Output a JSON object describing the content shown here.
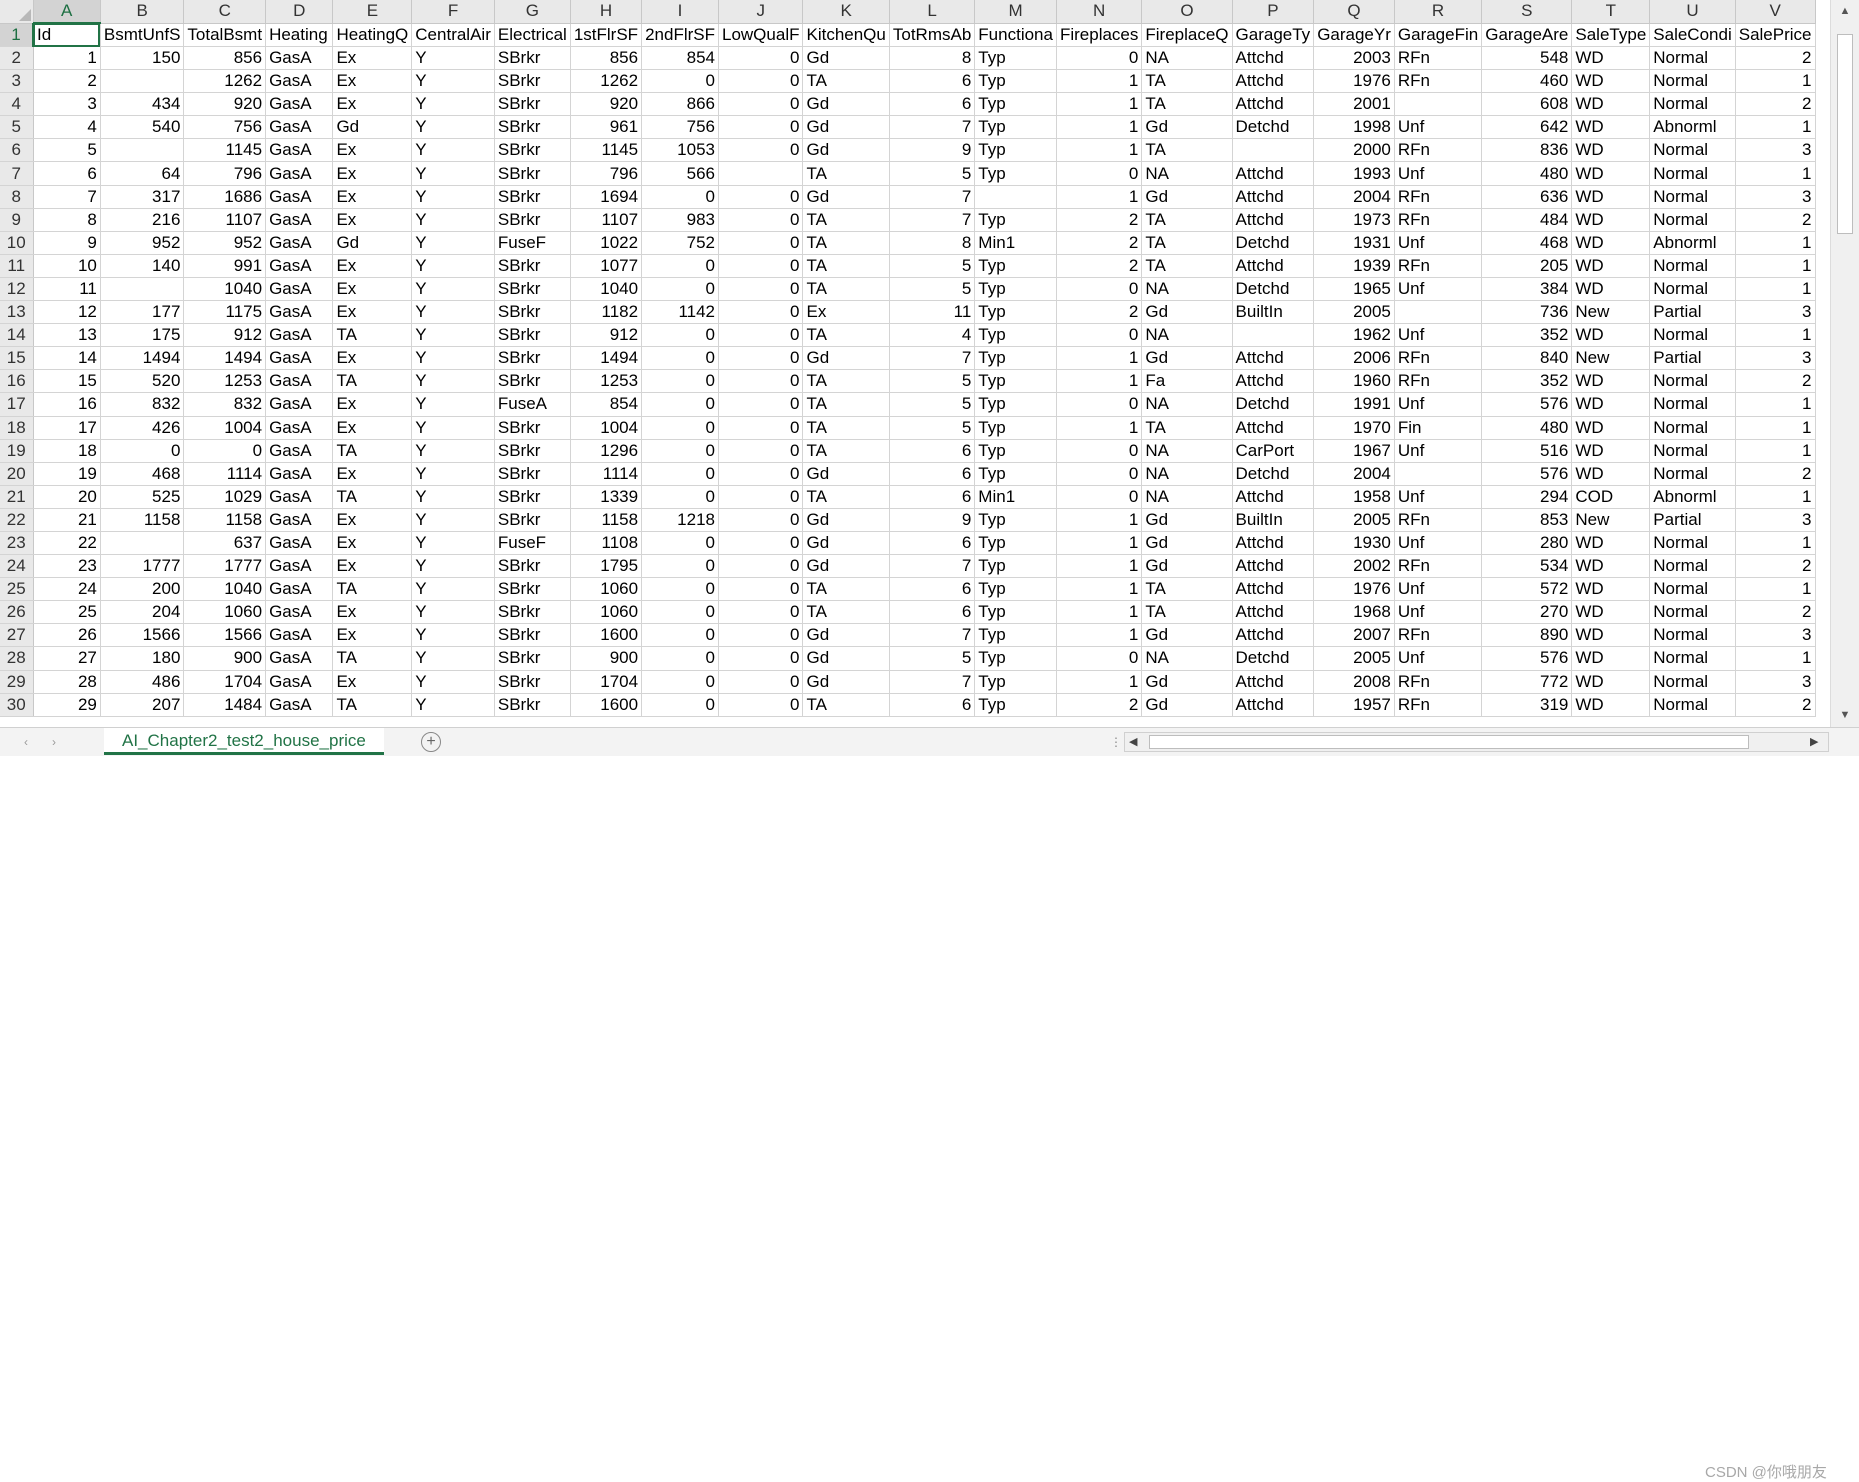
{
  "sheet": {
    "columns": [
      "A",
      "B",
      "C",
      "D",
      "E",
      "F",
      "G",
      "H",
      "I",
      "J",
      "K",
      "L",
      "M",
      "N",
      "O",
      "P",
      "Q",
      "R",
      "S",
      "T",
      "U",
      "V"
    ],
    "selected_cell": "A1",
    "rows": [
      {
        "n": "1",
        "c": [
          "Id",
          "BsmtUnfS",
          "TotalBsmt",
          "Heating",
          "HeatingQ",
          "CentralAir",
          "Electrical",
          "1stFlrSF",
          "2ndFlrSF",
          "LowQualF",
          "KitchenQu",
          "TotRmsAb",
          "Functiona",
          "Fireplaces",
          "FireplaceQ",
          "GarageTy",
          "GarageYr",
          "GarageFin",
          "GarageAre",
          "SaleType",
          "SaleCondi",
          "SalePrice"
        ]
      },
      {
        "n": "2",
        "c": [
          "1",
          "150",
          "856",
          "GasA",
          "Ex",
          "Y",
          "SBrkr",
          "856",
          "854",
          "0",
          "Gd",
          "8",
          "Typ",
          "0",
          "NA",
          "Attchd",
          "2003",
          "RFn",
          "548",
          "WD",
          "Normal",
          "2"
        ]
      },
      {
        "n": "3",
        "c": [
          "2",
          "",
          "1262",
          "GasA",
          "Ex",
          "Y",
          "SBrkr",
          "1262",
          "0",
          "0",
          "TA",
          "6",
          "Typ",
          "1",
          "TA",
          "Attchd",
          "1976",
          "RFn",
          "460",
          "WD",
          "Normal",
          "1"
        ]
      },
      {
        "n": "4",
        "c": [
          "3",
          "434",
          "920",
          "GasA",
          "Ex",
          "Y",
          "SBrkr",
          "920",
          "866",
          "0",
          "Gd",
          "6",
          "Typ",
          "1",
          "TA",
          "Attchd",
          "2001",
          "",
          "608",
          "WD",
          "Normal",
          "2"
        ]
      },
      {
        "n": "5",
        "c": [
          "4",
          "540",
          "756",
          "GasA",
          "Gd",
          "Y",
          "SBrkr",
          "961",
          "756",
          "0",
          "Gd",
          "7",
          "Typ",
          "1",
          "Gd",
          "Detchd",
          "1998",
          "Unf",
          "642",
          "WD",
          "Abnorml",
          "1"
        ]
      },
      {
        "n": "6",
        "c": [
          "5",
          "",
          "1145",
          "GasA",
          "Ex",
          "Y",
          "SBrkr",
          "1145",
          "1053",
          "0",
          "Gd",
          "9",
          "Typ",
          "1",
          "TA",
          "",
          "2000",
          "RFn",
          "836",
          "WD",
          "Normal",
          "3"
        ]
      },
      {
        "n": "7",
        "c": [
          "6",
          "64",
          "796",
          "GasA",
          "Ex",
          "Y",
          "SBrkr",
          "796",
          "566",
          "",
          "TA",
          "5",
          "Typ",
          "0",
          "NA",
          "Attchd",
          "1993",
          "Unf",
          "480",
          "WD",
          "Normal",
          "1"
        ]
      },
      {
        "n": "8",
        "c": [
          "7",
          "317",
          "1686",
          "GasA",
          "Ex",
          "Y",
          "SBrkr",
          "1694",
          "0",
          "0",
          "Gd",
          "7",
          "",
          "1",
          "Gd",
          "Attchd",
          "2004",
          "RFn",
          "636",
          "WD",
          "Normal",
          "3"
        ]
      },
      {
        "n": "9",
        "c": [
          "8",
          "216",
          "1107",
          "GasA",
          "Ex",
          "Y",
          "SBrkr",
          "1107",
          "983",
          "0",
          "TA",
          "7",
          "Typ",
          "2",
          "TA",
          "Attchd",
          "1973",
          "RFn",
          "484",
          "WD",
          "Normal",
          "2"
        ]
      },
      {
        "n": "10",
        "c": [
          "9",
          "952",
          "952",
          "GasA",
          "Gd",
          "Y",
          "FuseF",
          "1022",
          "752",
          "0",
          "TA",
          "8",
          "Min1",
          "2",
          "TA",
          "Detchd",
          "1931",
          "Unf",
          "468",
          "WD",
          "Abnorml",
          "1"
        ]
      },
      {
        "n": "11",
        "c": [
          "10",
          "140",
          "991",
          "GasA",
          "Ex",
          "Y",
          "SBrkr",
          "1077",
          "0",
          "0",
          "TA",
          "5",
          "Typ",
          "2",
          "TA",
          "Attchd",
          "1939",
          "RFn",
          "205",
          "WD",
          "Normal",
          "1"
        ]
      },
      {
        "n": "12",
        "c": [
          "11",
          "",
          "1040",
          "GasA",
          "Ex",
          "Y",
          "SBrkr",
          "1040",
          "0",
          "0",
          "TA",
          "5",
          "Typ",
          "0",
          "NA",
          "Detchd",
          "1965",
          "Unf",
          "384",
          "WD",
          "Normal",
          "1"
        ]
      },
      {
        "n": "13",
        "c": [
          "12",
          "177",
          "1175",
          "GasA",
          "Ex",
          "Y",
          "SBrkr",
          "1182",
          "1142",
          "0",
          "Ex",
          "11",
          "Typ",
          "2",
          "Gd",
          "BuiltIn",
          "2005",
          "",
          "736",
          "New",
          "Partial",
          "3"
        ]
      },
      {
        "n": "14",
        "c": [
          "13",
          "175",
          "912",
          "GasA",
          "TA",
          "Y",
          "SBrkr",
          "912",
          "0",
          "0",
          "TA",
          "4",
          "Typ",
          "0",
          "NA",
          "",
          "1962",
          "Unf",
          "352",
          "WD",
          "Normal",
          "1"
        ]
      },
      {
        "n": "15",
        "c": [
          "14",
          "1494",
          "1494",
          "GasA",
          "Ex",
          "Y",
          "SBrkr",
          "1494",
          "0",
          "0",
          "Gd",
          "7",
          "Typ",
          "1",
          "Gd",
          "Attchd",
          "2006",
          "RFn",
          "840",
          "New",
          "Partial",
          "3"
        ]
      },
      {
        "n": "16",
        "c": [
          "15",
          "520",
          "1253",
          "GasA",
          "TA",
          "Y",
          "SBrkr",
          "1253",
          "0",
          "0",
          "TA",
          "5",
          "Typ",
          "1",
          "Fa",
          "Attchd",
          "1960",
          "RFn",
          "352",
          "WD",
          "Normal",
          "2"
        ]
      },
      {
        "n": "17",
        "c": [
          "16",
          "832",
          "832",
          "GasA",
          "Ex",
          "Y",
          "FuseA",
          "854",
          "0",
          "0",
          "TA",
          "5",
          "Typ",
          "0",
          "NA",
          "Detchd",
          "1991",
          "Unf",
          "576",
          "WD",
          "Normal",
          "1"
        ]
      },
      {
        "n": "18",
        "c": [
          "17",
          "426",
          "1004",
          "GasA",
          "Ex",
          "Y",
          "SBrkr",
          "1004",
          "0",
          "0",
          "TA",
          "5",
          "Typ",
          "1",
          "TA",
          "Attchd",
          "1970",
          "Fin",
          "480",
          "WD",
          "Normal",
          "1"
        ]
      },
      {
        "n": "19",
        "c": [
          "18",
          "0",
          "0",
          "GasA",
          "TA",
          "Y",
          "SBrkr",
          "1296",
          "0",
          "0",
          "TA",
          "6",
          "Typ",
          "0",
          "NA",
          "CarPort",
          "1967",
          "Unf",
          "516",
          "WD",
          "Normal",
          "1"
        ]
      },
      {
        "n": "20",
        "c": [
          "19",
          "468",
          "1114",
          "GasA",
          "Ex",
          "Y",
          "SBrkr",
          "1114",
          "0",
          "0",
          "Gd",
          "6",
          "Typ",
          "0",
          "NA",
          "Detchd",
          "2004",
          "",
          "576",
          "WD",
          "Normal",
          "2"
        ]
      },
      {
        "n": "21",
        "c": [
          "20",
          "525",
          "1029",
          "GasA",
          "TA",
          "Y",
          "SBrkr",
          "1339",
          "0",
          "0",
          "TA",
          "6",
          "Min1",
          "0",
          "NA",
          "Attchd",
          "1958",
          "Unf",
          "294",
          "COD",
          "Abnorml",
          "1"
        ]
      },
      {
        "n": "22",
        "c": [
          "21",
          "1158",
          "1158",
          "GasA",
          "Ex",
          "Y",
          "SBrkr",
          "1158",
          "1218",
          "0",
          "Gd",
          "9",
          "Typ",
          "1",
          "Gd",
          "BuiltIn",
          "2005",
          "RFn",
          "853",
          "New",
          "Partial",
          "3"
        ]
      },
      {
        "n": "23",
        "c": [
          "22",
          "",
          "637",
          "GasA",
          "Ex",
          "Y",
          "FuseF",
          "1108",
          "0",
          "0",
          "Gd",
          "6",
          "Typ",
          "1",
          "Gd",
          "Attchd",
          "1930",
          "Unf",
          "280",
          "WD",
          "Normal",
          "1"
        ]
      },
      {
        "n": "24",
        "c": [
          "23",
          "1777",
          "1777",
          "GasA",
          "Ex",
          "Y",
          "SBrkr",
          "1795",
          "0",
          "0",
          "Gd",
          "7",
          "Typ",
          "1",
          "Gd",
          "Attchd",
          "2002",
          "RFn",
          "534",
          "WD",
          "Normal",
          "2"
        ]
      },
      {
        "n": "25",
        "c": [
          "24",
          "200",
          "1040",
          "GasA",
          "TA",
          "Y",
          "SBrkr",
          "1060",
          "0",
          "0",
          "TA",
          "6",
          "Typ",
          "1",
          "TA",
          "Attchd",
          "1976",
          "Unf",
          "572",
          "WD",
          "Normal",
          "1"
        ]
      },
      {
        "n": "26",
        "c": [
          "25",
          "204",
          "1060",
          "GasA",
          "Ex",
          "Y",
          "SBrkr",
          "1060",
          "0",
          "0",
          "TA",
          "6",
          "Typ",
          "1",
          "TA",
          "Attchd",
          "1968",
          "Unf",
          "270",
          "WD",
          "Normal",
          "2"
        ]
      },
      {
        "n": "27",
        "c": [
          "26",
          "1566",
          "1566",
          "GasA",
          "Ex",
          "Y",
          "SBrkr",
          "1600",
          "0",
          "0",
          "Gd",
          "7",
          "Typ",
          "1",
          "Gd",
          "Attchd",
          "2007",
          "RFn",
          "890",
          "WD",
          "Normal",
          "3"
        ]
      },
      {
        "n": "28",
        "c": [
          "27",
          "180",
          "900",
          "GasA",
          "TA",
          "Y",
          "SBrkr",
          "900",
          "0",
          "0",
          "Gd",
          "5",
          "Typ",
          "0",
          "NA",
          "Detchd",
          "2005",
          "Unf",
          "576",
          "WD",
          "Normal",
          "1"
        ]
      },
      {
        "n": "29",
        "c": [
          "28",
          "486",
          "1704",
          "GasA",
          "Ex",
          "Y",
          "SBrkr",
          "1704",
          "0",
          "0",
          "Gd",
          "7",
          "Typ",
          "1",
          "Gd",
          "Attchd",
          "2008",
          "RFn",
          "772",
          "WD",
          "Normal",
          "3"
        ]
      },
      {
        "n": "30",
        "c": [
          "29",
          "207",
          "1484",
          "GasA",
          "TA",
          "Y",
          "SBrkr",
          "1600",
          "0",
          "0",
          "TA",
          "6",
          "Typ",
          "2",
          "Gd",
          "Attchd",
          "1957",
          "RFn",
          "319",
          "WD",
          "Normal",
          "2"
        ]
      }
    ]
  },
  "tabs": {
    "sheet_name": "AI_Chapter2_test2_house_price",
    "add_symbol": "+",
    "prev_icon": "‹",
    "next_icon": "›",
    "split_icon": "⋮"
  },
  "scrollbars": {
    "up_icon": "▲",
    "down_icon": "▼",
    "left_icon": "◀",
    "right_icon": "▶"
  },
  "watermark": "CSDN @你哦朋友",
  "colors": {
    "accent": "#217346",
    "header_bg": "#e9e9e9",
    "grid_line": "#d4d4d4"
  }
}
